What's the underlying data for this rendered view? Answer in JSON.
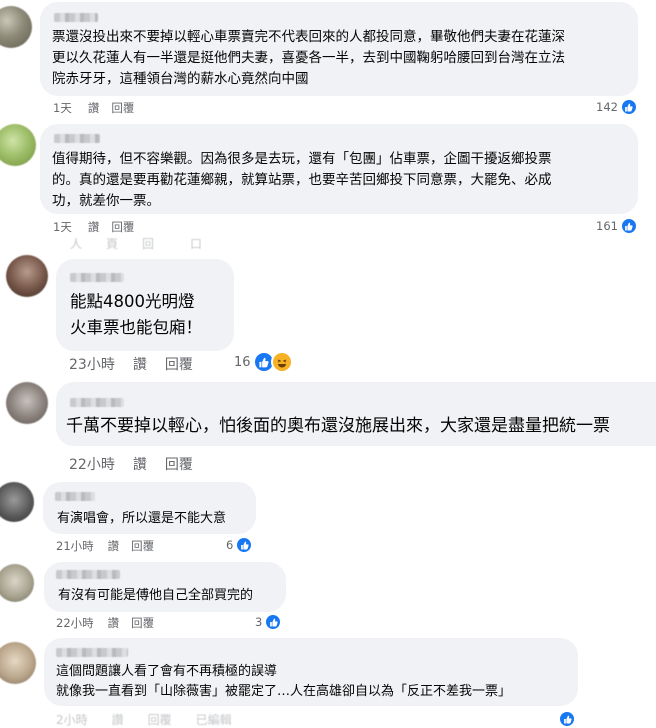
{
  "comments": [
    {
      "text": "票還沒投出來不要掉以輕心車票賣完不代表回來的人都投同意，畢敬他們夫妻在花蓮深\n更以久花蓮人有一半還是挺他們夫妻，喜憂各一半，去到中國鞠躬哈腰回到台灣在立法\n院赤牙牙，這種領台灣的薪水心竟然向中國",
      "time": "1天",
      "like": "讚",
      "reply": "回覆",
      "reactions": "142",
      "reaction_icons": [
        "like-icon"
      ]
    },
    {
      "text": "值得期待，但不容樂觀。因為很多是去玩，還有「包團」佔車票，企圖干擾返鄉投票\n的。真的還是要再勸花蓮鄉親，就算站票，也要辛苦回鄉投下同意票，大罷免、必成\n功，就差你一票。",
      "time": "1天",
      "like": "讚",
      "reply": "回覆",
      "reactions": "161",
      "reaction_icons": [
        "like-icon"
      ]
    },
    {
      "text": "能點4800光明燈\n火車票也能包廂！",
      "time": "23小時",
      "like": "讚",
      "reply": "回覆",
      "reactions": "16",
      "reaction_icons": [
        "like-icon",
        "haha-icon"
      ]
    },
    {
      "text": "千萬不要掉以輕心，怕後面的奧布還沒施展出來，大家還是盡量把統一票",
      "time": "22小時",
      "like": "讚",
      "reply": "回覆",
      "reactions": "",
      "reaction_icons": []
    },
    {
      "text": "有演唱會，所以還是不能大意",
      "time": "21小時",
      "like": "讚",
      "reply": "回覆",
      "reactions": "6",
      "reaction_icons": [
        "like-icon"
      ]
    },
    {
      "text": "有沒有可能是傅他自己全部買完的",
      "time": "22小時",
      "like": "讚",
      "reply": "回覆",
      "reactions": "3",
      "reaction_icons": [
        "like-icon"
      ]
    },
    {
      "text": "這個問題讓人看了會有不再積極的誤導\n就像我一直看到「山除薇害」被罷定了…人在高雄卻自以為「反正不差我一票」",
      "time": "",
      "like": "",
      "reply": "",
      "reactions": "",
      "reaction_icons": [
        "like-icon"
      ]
    }
  ],
  "colors": {
    "like_blue": "#1877f2",
    "haha_yellow": "#f7b125",
    "bubble_bg": "#f0f2f5",
    "meta_gray": "#65676b"
  }
}
